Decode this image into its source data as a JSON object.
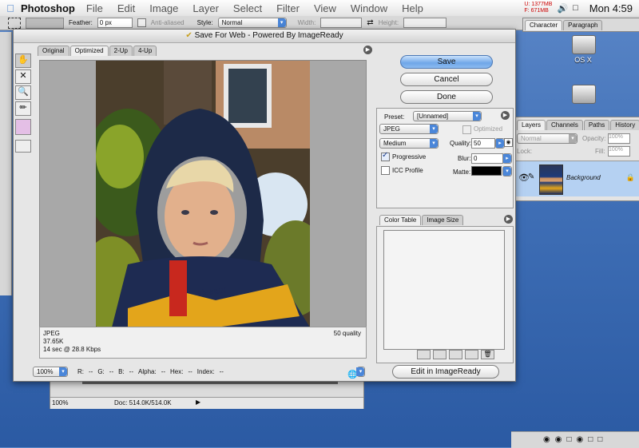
{
  "menubar": {
    "app": "Photoshop",
    "menus": [
      "File",
      "Edit",
      "Image",
      "Layer",
      "Select",
      "Filter",
      "View",
      "Window",
      "Help"
    ],
    "memory_used": "U: 1377MB",
    "memory_free": "F: 671MB",
    "clock": "Mon 4:59"
  },
  "options": {
    "feather_label": "Feather:",
    "feather_value": "0 px",
    "antialiased_label": "Anti-aliased",
    "style_label": "Style:",
    "style_value": "Normal",
    "width_label": "Width:",
    "height_label": "Height:"
  },
  "dialog": {
    "title": "Save For Web - Powered By ImageReady",
    "tabs": [
      "Original",
      "Optimized",
      "2-Up",
      "4-Up"
    ],
    "info": {
      "format": "JPEG",
      "size": "37.65K",
      "download": "14 sec @ 28.8 Kbps",
      "quality": "50 quality"
    },
    "status": {
      "zoom": "100%",
      "r_label": "R:",
      "r_value": "--",
      "g_label": "G:",
      "g_value": "--",
      "b_label": "B:",
      "b_value": "--",
      "alpha_label": "Alpha:",
      "alpha_value": "--",
      "hex_label": "Hex:",
      "hex_value": "--",
      "index_label": "Index:",
      "index_value": "--"
    },
    "buttons": {
      "save": "Save",
      "cancel": "Cancel",
      "done": "Done",
      "edit_imageready": "Edit in ImageReady"
    },
    "settings": {
      "preset_label": "Preset:",
      "preset_value": "[Unnamed]",
      "format_value": "JPEG",
      "optimized_label": "Optimized",
      "quality_level": "Medium",
      "quality_label": "Quality:",
      "quality_value": "50",
      "progressive_label": "Progressive",
      "progressive_checked": true,
      "blur_label": "Blur:",
      "blur_value": "0",
      "icc_label": "ICC Profile",
      "icc_checked": false,
      "matte_label": "Matte:"
    },
    "color_tabs": [
      "Color Table",
      "Image Size"
    ]
  },
  "right": {
    "char_tabs": [
      "Character",
      "Paragraph"
    ],
    "desktop_label": "OS X",
    "layers_tabs": [
      "Layers",
      "Channels",
      "Paths",
      "History"
    ],
    "blend_mode": "Normal",
    "opacity_label": "Opacity:",
    "opacity_value": "100%",
    "lock_label": "Lock:",
    "fill_label": "Fill:",
    "fill_value": "100%",
    "layer_name": "Background"
  },
  "lower": {
    "zoom": "100%",
    "doc": "Doc: 514.0K/514.0K"
  },
  "colors": {
    "accent": "#4a86d9",
    "selected_layer": "#b5d1f2"
  }
}
